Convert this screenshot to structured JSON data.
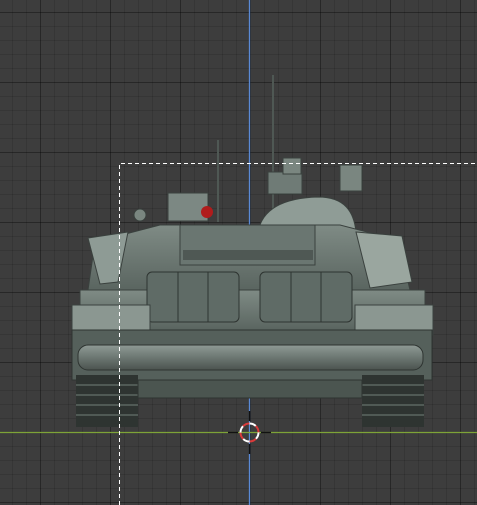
{
  "editor": {
    "view": "3d-viewport-front-orthographic",
    "model": "tank-front-view",
    "colors": {
      "background": "#3d3d3d",
      "axis_z": "#5a8ad6",
      "axis_y": "#7ea337",
      "selection_border": "#ffffff",
      "model_body": "#6d7a74",
      "model_dark": "#2e3431",
      "model_light": "#8b9791",
      "cursor_red": "#d93a3a",
      "cursor_white": "#ffffff",
      "marker_red": "#b01c1c"
    },
    "icons": [
      "3d-cursor-icon"
    ]
  }
}
